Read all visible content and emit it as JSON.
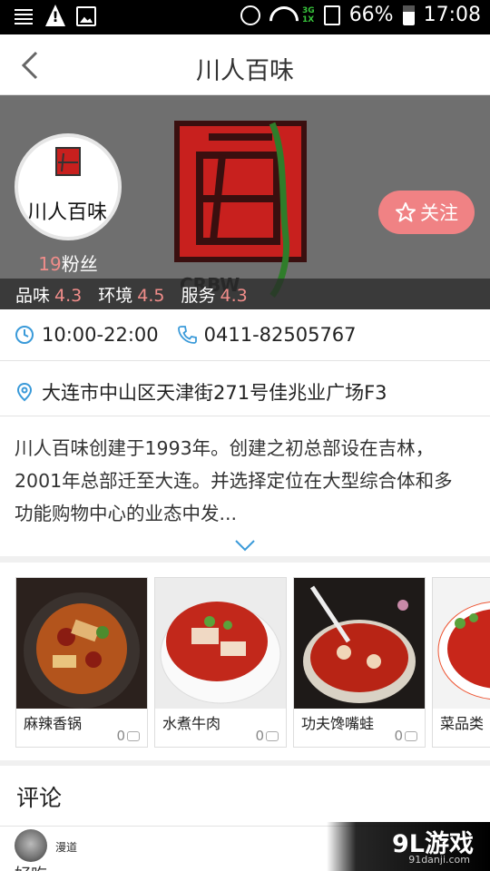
{
  "status_bar": {
    "network": "3G\n1X",
    "battery": "66%",
    "time": "17:08",
    "icons": [
      "menu-icon",
      "warning-icon",
      "image-icon",
      "alarm-icon",
      "wifi-icon",
      "sim-icon",
      "battery-icon"
    ]
  },
  "header": {
    "title": "川人百味"
  },
  "banner": {
    "fans_count": "19",
    "fans_label": "粉丝",
    "follow_label": "关注",
    "ratings": [
      {
        "label": "品味",
        "value": "4.3"
      },
      {
        "label": "环境",
        "value": "4.5"
      },
      {
        "label": "服务",
        "value": "4.3"
      }
    ],
    "logo_text": "CRBW",
    "avatar_text": "川人百味"
  },
  "info": {
    "hours": "10:00-22:00",
    "phone": "0411-82505767",
    "address": "大连市中山区天津街271号佳兆业广场F3",
    "description": "川人百味创建于1993年。创建之初总部设在吉林，2001年总部迁至大连。并选择定位在大型综合体和多功能购物中心的业态中发..."
  },
  "dishes": [
    {
      "name": "麻辣香锅",
      "count": "0"
    },
    {
      "name": "水煮牛肉",
      "count": "0"
    },
    {
      "name": "功夫馋嘴蛙",
      "count": "0"
    },
    {
      "name": "菜品类",
      "count": ""
    }
  ],
  "comments": {
    "title": "评论",
    "first_user": "漫道",
    "first_text": "好吃"
  },
  "watermark": {
    "main": "9L游戏",
    "sub": "91danji.com"
  },
  "colors": {
    "accent": "#f08284",
    "rating_value": "#f08d8a",
    "icon_blue": "#3a9ad9"
  }
}
